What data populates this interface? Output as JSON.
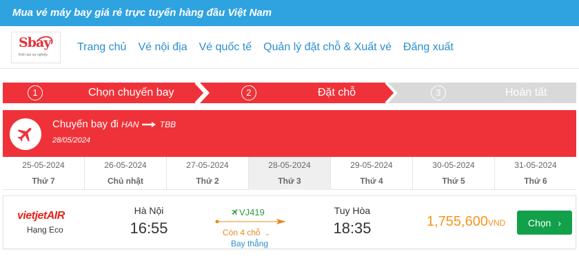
{
  "banner": {
    "text": "Mua vé máy bay giá rẻ trực tuyến hàng đầu Việt Nam"
  },
  "logo": {
    "text": "Sbay",
    "tagline": "Kiến tạo sự nghiệp"
  },
  "nav": [
    {
      "label": "Trang chủ"
    },
    {
      "label": "Vé nội địa"
    },
    {
      "label": "Vé quốc tế"
    },
    {
      "label": "Quản lý đặt chỗ & Xuất vé"
    },
    {
      "label": "Đăng xuất"
    }
  ],
  "steps": [
    {
      "number": "1",
      "label": "Chọn chuyến bay",
      "state": "completed"
    },
    {
      "number": "2",
      "label": "Đặt chỗ",
      "state": "active"
    },
    {
      "number": "3",
      "label": "Hoàn tất",
      "state": "pending"
    }
  ],
  "route": {
    "title": "Chuyến bay đi",
    "from": "HAN",
    "to": "TBB",
    "date": "28/05/2024",
    "icon": "airplane-icon"
  },
  "dates": [
    {
      "date": "25-05-2024",
      "weekday": "Thứ 7"
    },
    {
      "date": "26-05-2024",
      "weekday": "Chủ nhật"
    },
    {
      "date": "27-05-2024",
      "weekday": "Thứ 2"
    },
    {
      "date": "28-05-2024",
      "weekday": "Thứ 3",
      "active": true
    },
    {
      "date": "29-05-2024",
      "weekday": "Thứ 4"
    },
    {
      "date": "30-05-2024",
      "weekday": "Thứ 5"
    },
    {
      "date": "31-05-2024",
      "weekday": "Thứ 6"
    }
  ],
  "flight": {
    "airline": "VietJet Air",
    "airline_logo_text": "vietjetAIR",
    "cabin": "Hạng Eco",
    "departure_city": "Hà Nội",
    "departure_time": "16:55",
    "flight_code": "VJ419",
    "seats_left": "Còn 4 chỗ",
    "stop_info": "Bay thẳng",
    "arrival_city": "Tuy Hòa",
    "arrival_time": "18:35",
    "price": "1,755,600",
    "currency": "VND",
    "select_label": "Chọn"
  },
  "colors": {
    "banner": "#2fa3e0",
    "primary_red": "#ef3239",
    "step_pending": "#d9d9d9",
    "link_blue": "#2b8ecf",
    "price_orange": "#f7941d",
    "select_green": "#12a14a"
  }
}
